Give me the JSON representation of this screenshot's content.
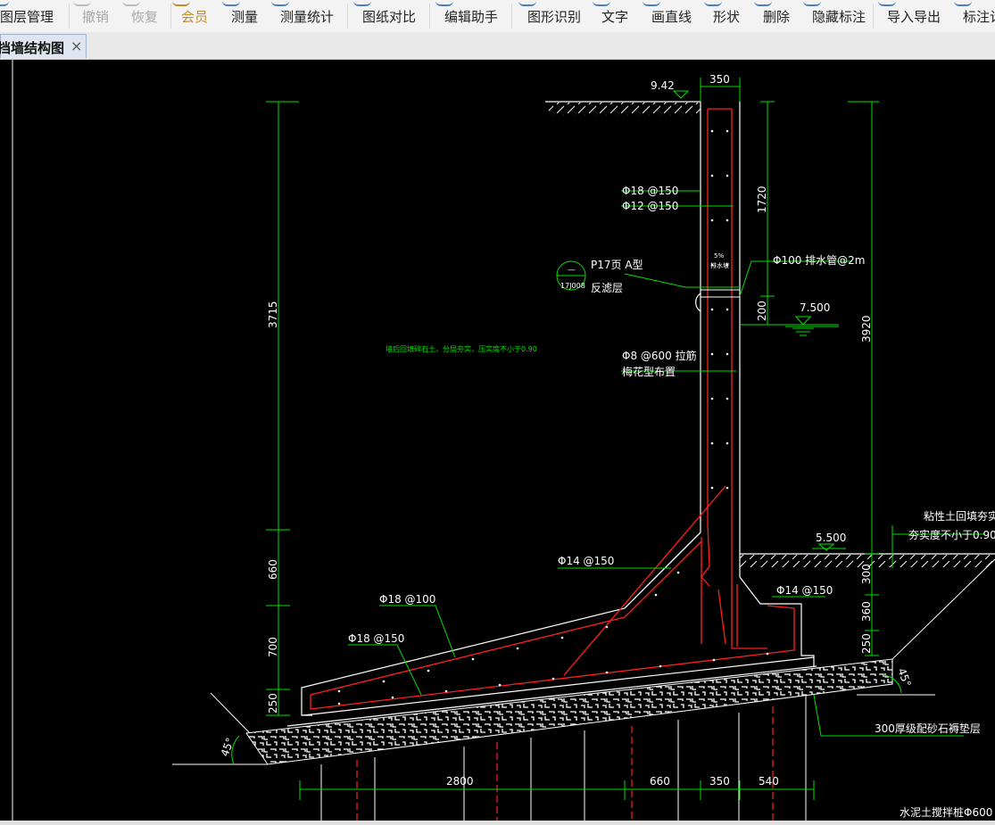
{
  "toolbar": {
    "items": [
      {
        "label": "图层管理",
        "icon": "layers-icon",
        "state": "normal"
      },
      {
        "label": "撤销",
        "icon": "undo-icon",
        "state": "disabled"
      },
      {
        "label": "恢复",
        "icon": "redo-icon",
        "state": "disabled"
      },
      {
        "label": "会员",
        "icon": "vip-icon",
        "state": "accent"
      },
      {
        "label": "测量",
        "icon": "measure-icon",
        "state": "normal"
      },
      {
        "label": "测量统计",
        "icon": "measure-stats-icon",
        "state": "normal"
      },
      {
        "label": "图纸对比",
        "icon": "compare-icon",
        "state": "normal"
      },
      {
        "label": "编辑助手",
        "icon": "edit-assistant-icon",
        "state": "normal"
      },
      {
        "label": "图形识别",
        "icon": "shape-recognition-icon",
        "state": "normal"
      },
      {
        "label": "文字",
        "icon": "text-icon",
        "state": "normal"
      },
      {
        "label": "画直线",
        "icon": "line-icon",
        "state": "normal"
      },
      {
        "label": "形状",
        "icon": "shape-icon",
        "state": "normal"
      },
      {
        "label": "删除",
        "icon": "delete-icon",
        "state": "normal"
      },
      {
        "label": "隐藏标注",
        "icon": "hide-annotation-icon",
        "state": "normal"
      },
      {
        "label": "导入导出",
        "icon": "import-export-icon",
        "state": "normal"
      },
      {
        "label": "标注计",
        "icon": "annotation-icon",
        "state": "normal"
      }
    ],
    "accent_color": "#c78a2a"
  },
  "tab": {
    "title": "挡墙结构图",
    "close": "×"
  },
  "drawing": {
    "top_width": "350",
    "elev_top": "9.42",
    "rebar_main_1": "Φ18 @150",
    "rebar_main_2": "Φ12 @150",
    "dim_1720": "1720",
    "slope_pct": "5%",
    "drain_label": "排水坡",
    "detail_ref_page": "P17页  A型",
    "detail_ref_atlas": "17J008",
    "detail_ref_symbol": "—",
    "filter_layer": "反滤层",
    "drain_pipe": "Φ100 排水管@2m",
    "elev_water": "7.500",
    "dim_200": "200",
    "dim_3920": "3920",
    "dim_3715": "3715",
    "backfill_note": "墙后回填碎石土，分层夯实，压实度不小于0.90",
    "tie_bar": "Φ8 @600 拉筋",
    "tie_bar_layout": "梅花型布置",
    "clay_note_1": "粘性土回填夯实",
    "clay_note_2": "夯实度不小于0.90",
    "elev_ground": "5.500",
    "rebar_heel": "Φ14 @150",
    "rebar_toe": "Φ14 @150",
    "rebar_top_slab": "Φ18 @100",
    "rebar_bottom_slab": "Φ18 @150",
    "dim_660v": "660",
    "dim_700": "700",
    "dim_250l": "250",
    "dim_300": "300",
    "dim_360": "360",
    "dim_250r": "250",
    "angle_left": "45°",
    "angle_right": "45°",
    "gravel_cushion": "300厚级配砂石褥垫层",
    "dim_2800": "2800",
    "dim_660h": "660",
    "dim_350b": "350",
    "dim_540": "540",
    "pile_note": "水泥土搅拌桩Φ600"
  },
  "colors": {
    "green": "#00e000",
    "red": "#ff2020",
    "white": "#ffffff",
    "bg": "#000000"
  }
}
